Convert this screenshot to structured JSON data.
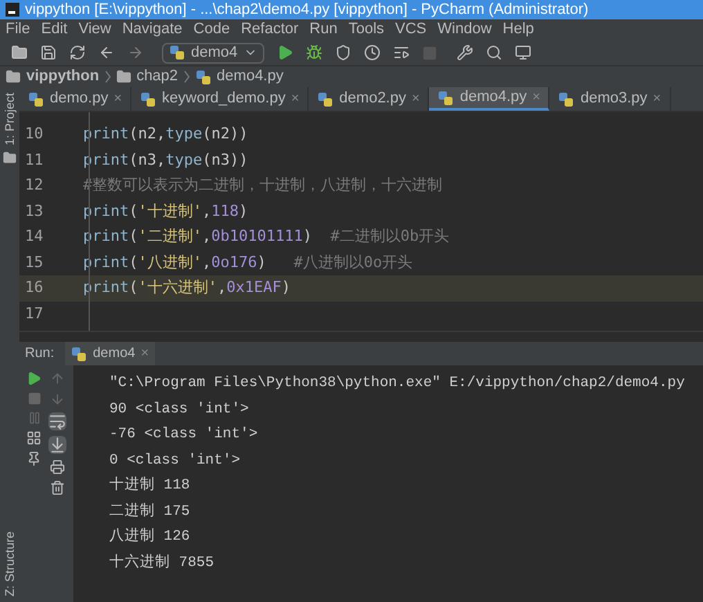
{
  "window": {
    "title": "vippython [E:\\vippython] - ...\\chap2\\demo4.py [vippython] - PyCharm (Administrator)"
  },
  "menu": [
    "File",
    "Edit",
    "View",
    "Navigate",
    "Code",
    "Refactor",
    "Run",
    "Tools",
    "VCS",
    "Window",
    "Help"
  ],
  "toolbar": {
    "run_config": "demo4",
    "stop_disabled": true
  },
  "breadcrumbs": [
    "vippython",
    "chap2",
    "demo4.py"
  ],
  "side_tabs": {
    "left_top": "1: Project",
    "left_bottom": "Z: Structure"
  },
  "tabs": [
    {
      "label": "demo.py",
      "close": "×",
      "selected": false
    },
    {
      "label": "keyword_demo.py",
      "close": "×",
      "selected": false
    },
    {
      "label": "demo2.py",
      "close": "×",
      "selected": false
    },
    {
      "label": "demo4.py",
      "close": "×",
      "selected": true
    },
    {
      "label": "demo3.py",
      "close": "×",
      "selected": false
    }
  ],
  "editor": {
    "lines": [
      {
        "number": "10",
        "current": false,
        "tokens": [
          {
            "kind": "fn",
            "text": "print"
          },
          {
            "kind": "plain",
            "text": "(n2,"
          },
          {
            "kind": "fn",
            "text": "type"
          },
          {
            "kind": "plain",
            "text": "(n2))"
          }
        ]
      },
      {
        "number": "11",
        "current": false,
        "tokens": [
          {
            "kind": "fn",
            "text": "print"
          },
          {
            "kind": "plain",
            "text": "(n3,"
          },
          {
            "kind": "fn",
            "text": "type"
          },
          {
            "kind": "plain",
            "text": "(n3))"
          }
        ]
      },
      {
        "number": "12",
        "current": false,
        "tokens": [
          {
            "kind": "comment",
            "text": "#整数可以表示为二进制，十进制，八进制，十六进制"
          }
        ]
      },
      {
        "number": "13",
        "current": false,
        "tokens": [
          {
            "kind": "fn",
            "text": "print"
          },
          {
            "kind": "plain",
            "text": "("
          },
          {
            "kind": "string",
            "text": "'十进制'"
          },
          {
            "kind": "plain",
            "text": ","
          },
          {
            "kind": "number",
            "text": "118"
          },
          {
            "kind": "plain",
            "text": ")"
          }
        ]
      },
      {
        "number": "14",
        "current": false,
        "tokens": [
          {
            "kind": "fn",
            "text": "print"
          },
          {
            "kind": "plain",
            "text": "("
          },
          {
            "kind": "string",
            "text": "'二进制'"
          },
          {
            "kind": "plain",
            "text": ","
          },
          {
            "kind": "number",
            "text": "0b10101111"
          },
          {
            "kind": "plain",
            "text": ")"
          },
          {
            "kind": "comment",
            "text": "  #二进制以0b开头"
          }
        ]
      },
      {
        "number": "15",
        "current": false,
        "tokens": [
          {
            "kind": "fn",
            "text": "print"
          },
          {
            "kind": "plain",
            "text": "("
          },
          {
            "kind": "string",
            "text": "'八进制'"
          },
          {
            "kind": "plain",
            "text": ","
          },
          {
            "kind": "number",
            "text": "0o176"
          },
          {
            "kind": "plain",
            "text": ")"
          },
          {
            "kind": "comment",
            "text": "   #八进制以0o开头"
          }
        ]
      },
      {
        "number": "16",
        "current": true,
        "tokens": [
          {
            "kind": "fn",
            "text": "print"
          },
          {
            "kind": "plain",
            "text": "("
          },
          {
            "kind": "string",
            "text": "'十六进制'"
          },
          {
            "kind": "plain",
            "text": ","
          },
          {
            "kind": "number",
            "text": "0x1EAF"
          },
          {
            "kind": "plain",
            "text": ")"
          }
        ]
      },
      {
        "number": "17",
        "current": false
      }
    ]
  },
  "run_panel": {
    "label": "Run:",
    "tab": {
      "label": "demo4",
      "close": "×"
    },
    "output": [
      "\"C:\\Program Files\\Python38\\python.exe\" E:/vippython/chap2/demo4.py",
      "90 <class 'int'>",
      "-76 <class 'int'>",
      "0 <class 'int'>",
      "十进制 118",
      "二进制 175",
      "八进制 126",
      "十六进制 7855"
    ]
  }
}
